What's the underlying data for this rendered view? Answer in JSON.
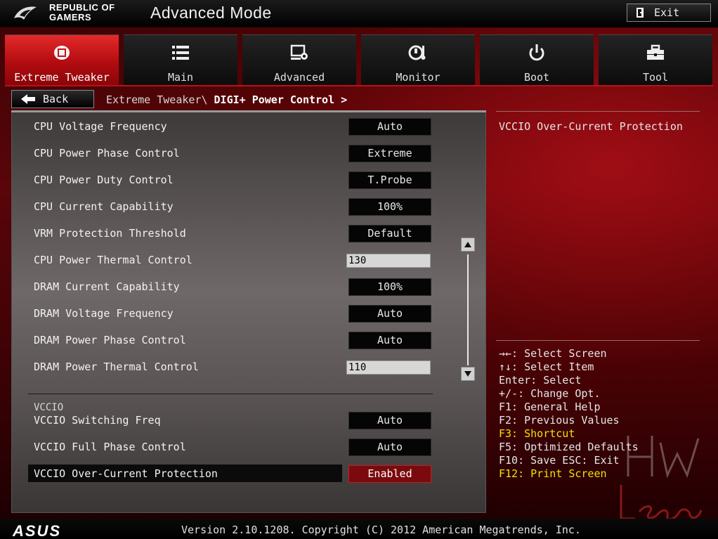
{
  "header": {
    "brand_line1": "REPUBLIC OF",
    "brand_line2": "GAMERS",
    "mode_title": "Advanced Mode",
    "exit_label": "Exit"
  },
  "tabs": [
    {
      "label": "Extreme Tweaker",
      "icon": "tweaker-icon",
      "active": true
    },
    {
      "label": "Main",
      "icon": "list-icon",
      "active": false
    },
    {
      "label": "Advanced",
      "icon": "advanced-icon",
      "active": false
    },
    {
      "label": "Monitor",
      "icon": "monitor-icon",
      "active": false
    },
    {
      "label": "Boot",
      "icon": "power-icon",
      "active": false
    },
    {
      "label": "Tool",
      "icon": "tool-icon",
      "active": false
    }
  ],
  "nav": {
    "back_label": "Back",
    "breadcrumb_path": "Extreme Tweaker\\ ",
    "breadcrumb_current": "DIGI+ Power Control >"
  },
  "settings": [
    {
      "label": "CPU Voltage Frequency",
      "value": "Auto"
    },
    {
      "label": "CPU Power Phase Control",
      "value": "Extreme"
    },
    {
      "label": "CPU Power Duty Control",
      "value": "T.Probe"
    },
    {
      "label": "CPU Current Capability",
      "value": "100%"
    },
    {
      "label": "VRM Protection Threshold",
      "value": "Default"
    },
    {
      "label": "CPU Power Thermal Control",
      "value": "130"
    },
    {
      "label": "DRAM Current Capability",
      "value": "100%"
    },
    {
      "label": "DRAM Voltage Frequency",
      "value": "Auto"
    },
    {
      "label": "DRAM Power Phase Control",
      "value": "Auto"
    },
    {
      "label": "DRAM Power Thermal Control",
      "value": "110"
    }
  ],
  "vccio": {
    "section_label": "VCCIO",
    "items": [
      {
        "label": "VCCIO Switching Freq",
        "value": "Auto"
      },
      {
        "label": "VCCIO Full Phase Control",
        "value": "Auto"
      },
      {
        "label": "VCCIO Over-Current Protection",
        "value": "Enabled"
      }
    ]
  },
  "help": {
    "title": "VCCIO Over-Current Protection",
    "shortcuts": [
      "→←: Select Screen",
      "↑↓: Select Item",
      "Enter: Select",
      "+/-: Change Opt.",
      "F1: General Help",
      "F2: Previous Values",
      "F3: Shortcut",
      "F5: Optimized Defaults",
      "F10: Save  ESC: Exit",
      "F12: Print Screen"
    ]
  },
  "footer": {
    "brand": "ASUS",
    "version": "Version 2.10.1208. Copyright (C) 2012 American Megatrends, Inc."
  },
  "watermark": {
    "text": "HW Legend"
  },
  "colors": {
    "accent": "#c41b22",
    "highlight_text": "#f5e000"
  }
}
